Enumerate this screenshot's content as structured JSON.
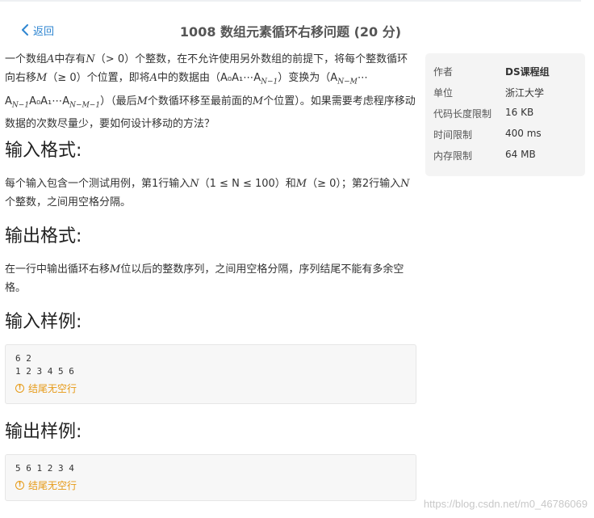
{
  "nav": {
    "back_label": "返回",
    "title": "1008 数组元素循环右移问题 (20 分)"
  },
  "description": {
    "p1_a": "一个数组",
    "p1_A": "A",
    "p1_b": "中存有",
    "p1_N": "N",
    "p1_c": "（> 0）个整数，在不允许使用另外数组的前提下，将每个整数循环向右移",
    "p1_M": "M",
    "p1_d": "（≥ 0）个位置，即将",
    "p1_A2": "A",
    "p1_e": "中的数据由（A₀A₁⋯A",
    "p1_sub1": "N−1",
    "p1_f": "）变换为（A",
    "p1_sub2": "N−M",
    "p1_g": "⋯A",
    "p1_sub3": "N−1",
    "p1_h": "A₀A₁⋯A",
    "p1_sub4": "N−M−1",
    "p1_i": "）（最后",
    "p1_M2": "M",
    "p1_j": "个数循环移至最前面的",
    "p1_M3": "M",
    "p1_k": "个位置）。如果需要考虑程序移动数据的次数尽量少，要如何设计移动的方法？"
  },
  "sections": {
    "input_heading": "输入格式:",
    "input_a": "每个输入包含一个测试用例，第1行输入",
    "input_N": "N",
    "input_b": "（1 ≤ N ≤ 100）和",
    "input_M": "M",
    "input_c": "（≥ 0）；第2行输入",
    "input_N2": "N",
    "input_d": "个整数，之间用空格分隔。",
    "output_heading": "输出格式:",
    "output_a": "在一行中输出循环右移",
    "output_M": "M",
    "output_b": "位以后的整数序列，之间用空格分隔，序列结尾不能有多余空格。",
    "sample_in_heading": "输入样例:",
    "sample_in_text": "6 2\n1 2 3 4 5 6",
    "sample_in_note": "结尾无空行",
    "sample_out_heading": "输出样例:",
    "sample_out_text": "5 6 1 2 3 4",
    "sample_out_note": "结尾无空行"
  },
  "info": {
    "author_label": "作者",
    "author_value": "DS课程组",
    "unit_label": "单位",
    "unit_value": "浙江大学",
    "code_label": "代码长度限制",
    "code_value": "16 KB",
    "time_label": "时间限制",
    "time_value": "400 ms",
    "mem_label": "内存限制",
    "mem_value": "64 MB"
  },
  "watermark": "https://blog.csdn.net/m0_46786069",
  "colors": {
    "link": "#2f86d1",
    "warning": "#e69a17"
  }
}
